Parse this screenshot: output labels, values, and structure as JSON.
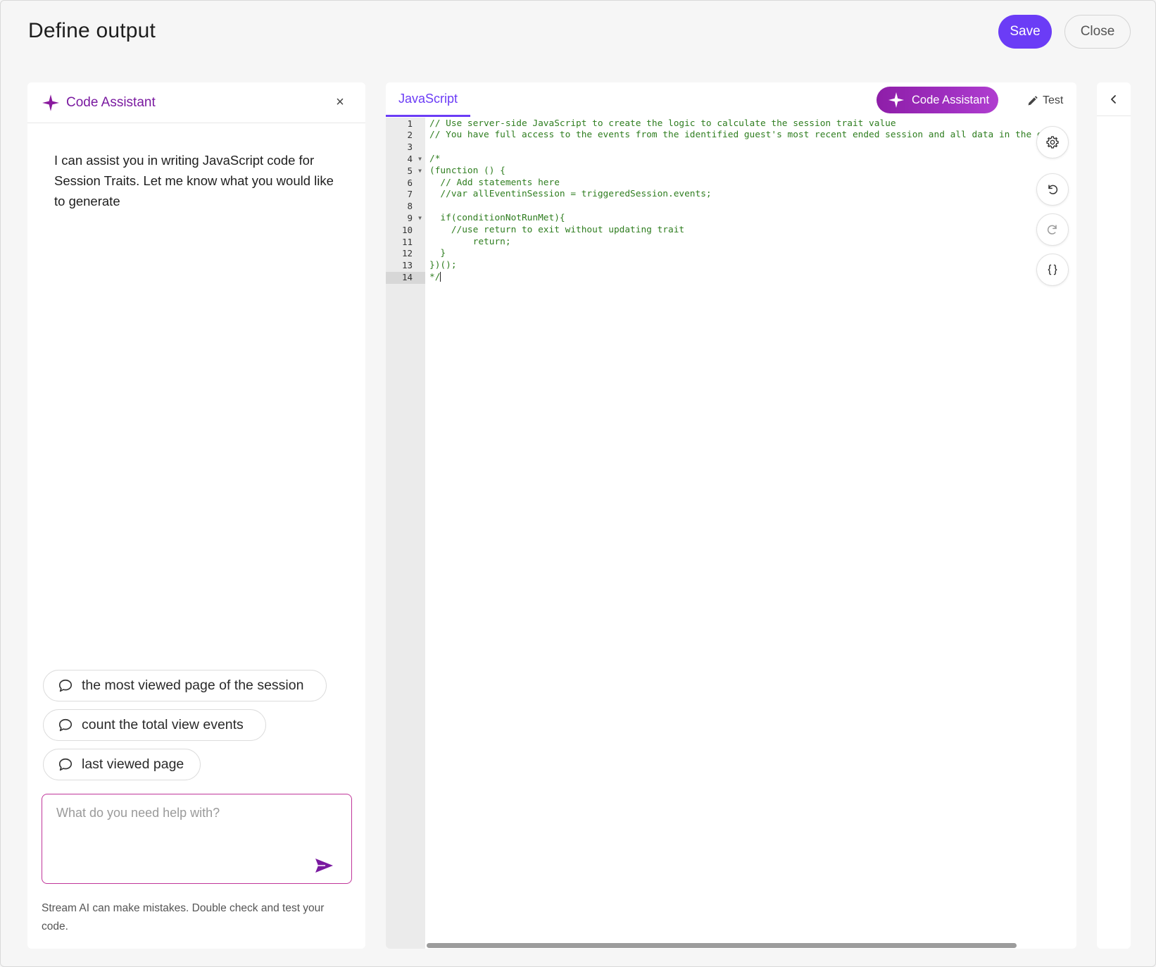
{
  "header": {
    "title": "Define output",
    "save_label": "Save",
    "close_label": "Close"
  },
  "assistant": {
    "title": "Code Assistant",
    "close_glyph": "×",
    "intro": "I can assist you in writing JavaScript code for Session Traits. Let me know what you would like to generate",
    "suggestions": [
      "the most viewed page of the session",
      "count the total view events",
      "last viewed page"
    ],
    "prompt_placeholder": "What do you need help with?",
    "disclaimer": "Stream AI can make mistakes. Double check and test your code."
  },
  "editor": {
    "tab_label": "JavaScript",
    "assistant_button_label": "Code Assistant",
    "test_label": "Test",
    "lines": [
      {
        "num": "1",
        "text": "// Use server-side JavaScript to create the logic to calculate the session trait value",
        "fold": false
      },
      {
        "num": "2",
        "text": "// You have full access to the events from the identified guest's most recent ended session and all data in the gu",
        "fold": false
      },
      {
        "num": "3",
        "text": "",
        "fold": false
      },
      {
        "num": "4",
        "text": "/*",
        "fold": true
      },
      {
        "num": "5",
        "text": "(function () {",
        "fold": true
      },
      {
        "num": "6",
        "text": "  // Add statements here",
        "fold": false
      },
      {
        "num": "7",
        "text": "  //var allEventinSession = triggeredSession.events;",
        "fold": false
      },
      {
        "num": "8",
        "text": "",
        "fold": false
      },
      {
        "num": "9",
        "text": "  if(conditionNotRunMet){",
        "fold": true
      },
      {
        "num": "10",
        "text": "    //use return to exit without updating trait",
        "fold": false
      },
      {
        "num": "11",
        "text": "        return;",
        "fold": false
      },
      {
        "num": "12",
        "text": "  }",
        "fold": false
      },
      {
        "num": "13",
        "text": "})();",
        "fold": false
      },
      {
        "num": "14",
        "text": "*/",
        "fold": false
      }
    ],
    "active_line": "14",
    "tool_icons": [
      "gear-icon",
      "undo-icon",
      "redo-icon",
      "braces-icon"
    ]
  },
  "colors": {
    "primary": "#6b3cf6",
    "assistant_accent": "#7a1aa0",
    "code_comment": "#2e7d1f"
  }
}
